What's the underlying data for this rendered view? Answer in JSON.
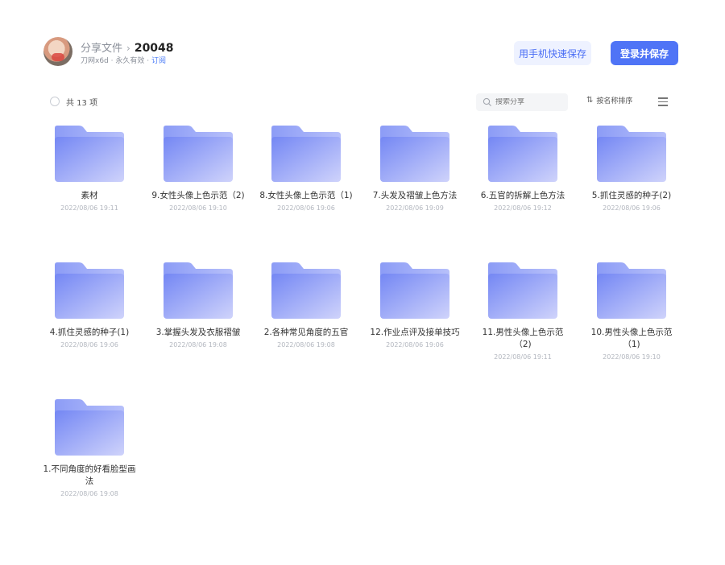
{
  "header": {
    "breadcrumb": "分享文件",
    "code": "20048",
    "owner": "刀网x6d",
    "validity": "· 永久有效 ·",
    "subscribe": "订阅",
    "btn_phone_save": "用手机快速保存",
    "btn_login_save": "登录并保存"
  },
  "toolbar": {
    "count": "共 13 项",
    "search_placeholder": "搜索分享",
    "sort_label": "按名称排序"
  },
  "icons": {
    "folder": "folder-icon",
    "search": "search-icon",
    "sort": "sort-icon",
    "menu": "list-view-icon"
  },
  "colors": {
    "accent": "#4f74f6",
    "folder_top": "#7b8ff5",
    "folder_bottom": "#c8cdfb"
  },
  "files": [
    {
      "name": "素材",
      "date": "2022/08/06 19:11"
    },
    {
      "name": "9.女性头像上色示范（2)",
      "date": "2022/08/06 19:10"
    },
    {
      "name": "8.女性头像上色示范（1)",
      "date": "2022/08/06 19:06"
    },
    {
      "name": "7.头发及褶皱上色方法",
      "date": "2022/08/06 19:09"
    },
    {
      "name": "6.五官的拆解上色方法",
      "date": "2022/08/06 19:12"
    },
    {
      "name": "5.抓住灵感的种子(2)",
      "date": "2022/08/06 19:06"
    },
    {
      "name": "4.抓住灵感的种子(1)",
      "date": "2022/08/06 19:06"
    },
    {
      "name": "3.掌握头发及衣服褶皱",
      "date": "2022/08/06 19:08"
    },
    {
      "name": "2.各种常见角度的五官",
      "date": "2022/08/06 19:08"
    },
    {
      "name": "12.作业点评及接单技巧",
      "date": "2022/08/06 19:06"
    },
    {
      "name": "11.男性头像上色示范（2)",
      "date": "2022/08/06 19:11"
    },
    {
      "name": "10.男性头像上色示范（1)",
      "date": "2022/08/06 19:10"
    },
    {
      "name": "1.不同角度的好看脸型画法",
      "date": "2022/08/06 19:08"
    }
  ]
}
